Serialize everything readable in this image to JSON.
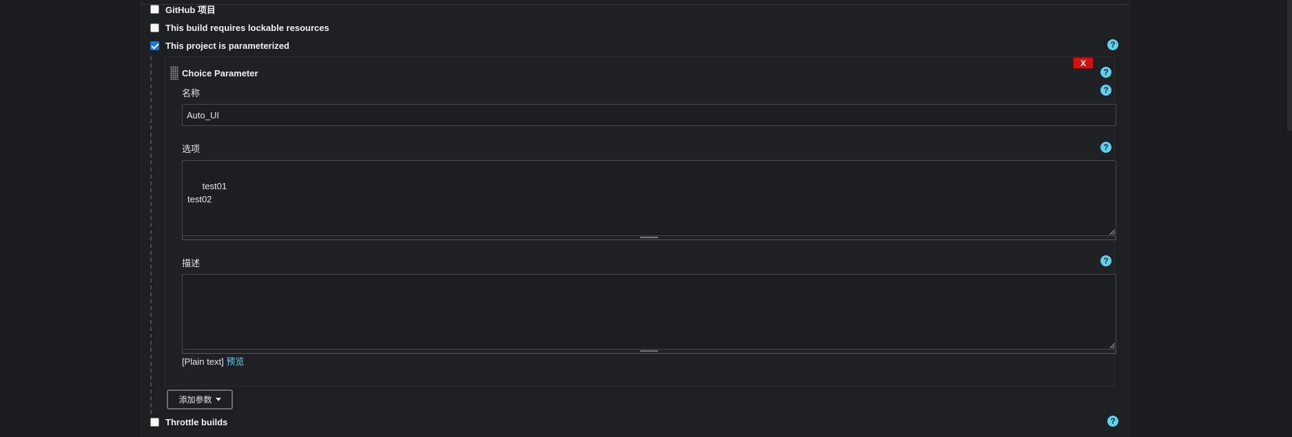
{
  "checkboxes": {
    "github": {
      "label": "GitHub 项目",
      "checked": false
    },
    "lockable": {
      "label": "This build requires lockable resources",
      "checked": false
    },
    "parameterized": {
      "label": "This project is parameterized",
      "checked": true
    },
    "throttle": {
      "label": "Throttle builds",
      "checked": false
    }
  },
  "param": {
    "title": "Choice Parameter",
    "delete_label": "X",
    "name_label": "名称",
    "name_value": "Auto_UI",
    "choices_label": "选项",
    "choices_value": "test01\ntest02",
    "description_label": "描述",
    "description_value": "",
    "plain_text": "[Plain text]",
    "preview_label": "预览"
  },
  "add_param_label": "添加参数",
  "icons": {
    "help": "?"
  },
  "colors": {
    "accent": "#5fd0f0",
    "delete": "#d11212",
    "checkbox_checked": "#1a73e8"
  }
}
